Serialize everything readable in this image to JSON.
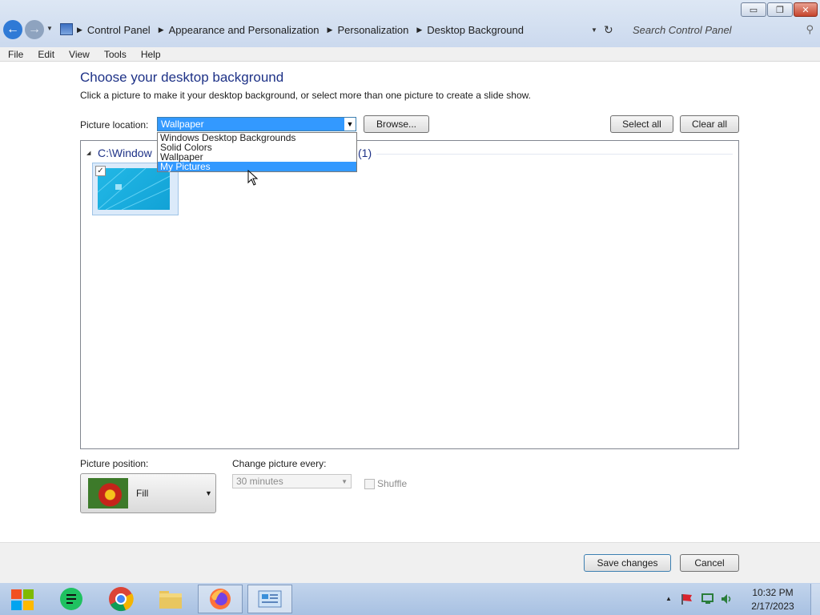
{
  "window": {
    "minimize_glyph": "▭",
    "maximize_glyph": "❐",
    "close_glyph": "✕"
  },
  "address_bar": {
    "breadcrumbs": [
      "Control Panel",
      "Appearance and Personalization",
      "Personalization",
      "Desktop Background"
    ],
    "search_placeholder": "Search Control Panel"
  },
  "menu": [
    "File",
    "Edit",
    "View",
    "Tools",
    "Help"
  ],
  "page": {
    "title": "Choose your desktop background",
    "subtitle": "Click a picture to make it your desktop background, or select more than one picture to create a slide show."
  },
  "picture_location": {
    "label": "Picture location:",
    "value": "Wallpaper",
    "options": [
      "Windows Desktop Backgrounds",
      "Solid Colors",
      "Wallpaper",
      "My Pictures"
    ],
    "highlighted": "My Pictures"
  },
  "buttons": {
    "browse": "Browse...",
    "select_all": "Select all",
    "clear_all": "Clear all",
    "save": "Save changes",
    "cancel": "Cancel"
  },
  "gallery": {
    "group_path": "C:\\Window",
    "group_count": "(1)",
    "thumbnail_checked": "✓"
  },
  "picture_position": {
    "label": "Picture position:",
    "value": "Fill"
  },
  "change_picture": {
    "label": "Change picture every:",
    "value": "30 minutes",
    "shuffle_label": "Shuffle"
  },
  "taskbar": {
    "icons": [
      "start-icon",
      "sheets-icon",
      "chrome-icon",
      "file-explorer-icon",
      "firefox-icon",
      "control-panel-icon"
    ],
    "time": "10:32 PM",
    "date": "2/17/2023"
  }
}
